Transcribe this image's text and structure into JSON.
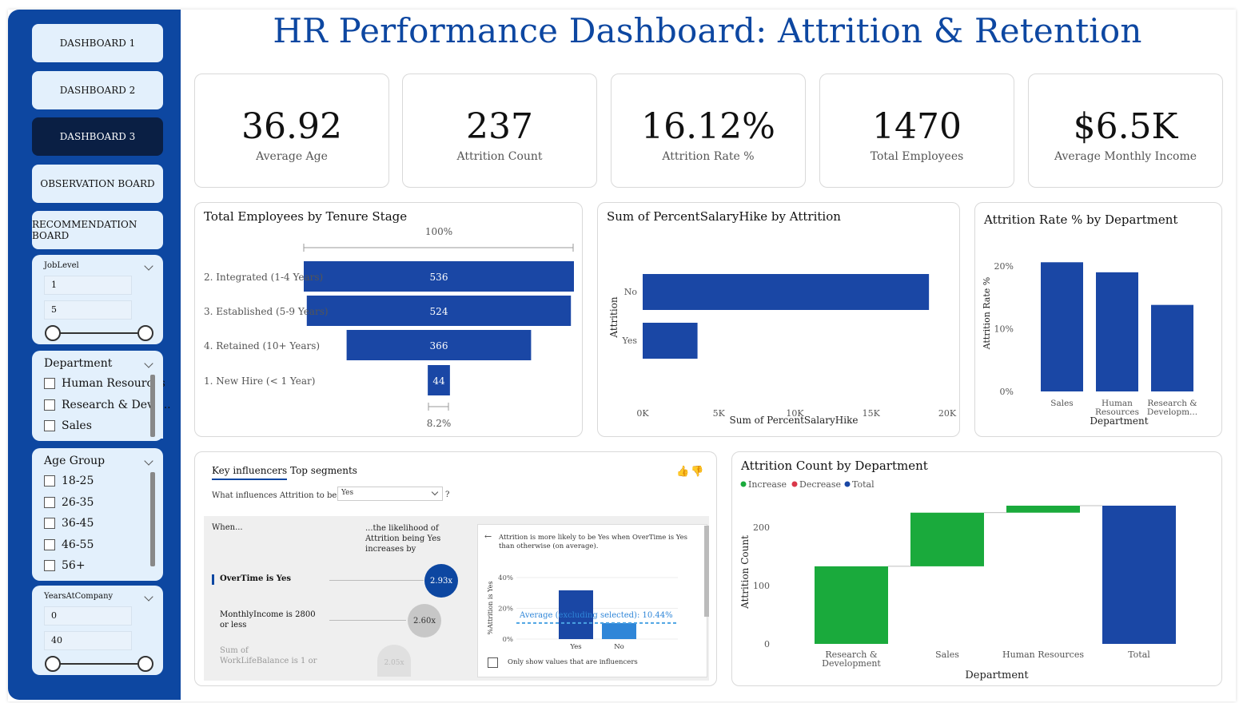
{
  "title": "HR Performance Dashboard: Attrition & Retention",
  "nav": {
    "dashboard1": "DASHBOARD 1",
    "dashboard2": "DASHBOARD 2",
    "dashboard3": "DASHBOARD 3",
    "observation": "OBSERVATION BOARD",
    "recommendation": "RECOMMENDATION BOARD",
    "active": "DASHBOARD 3"
  },
  "filters": {
    "joblevel": {
      "title": "JobLevel",
      "min": "1",
      "max": "5"
    },
    "department": {
      "title": "Department",
      "options": [
        "Human Resources",
        "Research & Deve...",
        "Sales"
      ]
    },
    "age_group": {
      "title": "Age Group",
      "options": [
        "18-25",
        "26-35",
        "36-45",
        "46-55",
        "56+"
      ]
    },
    "years": {
      "title": "YearsAtCompany",
      "min": "0",
      "max": "40"
    }
  },
  "kpis": [
    {
      "value": "36.92",
      "label": "Average Age"
    },
    {
      "value": "237",
      "label": "Attrition Count"
    },
    {
      "value": "16.12%",
      "label": "Attrition Rate %"
    },
    {
      "value": "1470",
      "label": "Total Employees"
    },
    {
      "value": "$6.5K",
      "label": "Average Monthly Income"
    }
  ],
  "colors": {
    "brand": "#0d47a1",
    "bar": "#1a47a5",
    "increase": "#1aaa3c",
    "decrease": "#d9384a",
    "total": "#1a47a5",
    "light": "#e3f0fc",
    "active_nav": "#0a1f44"
  },
  "chart_data": [
    {
      "type": "bar",
      "title": "Total Employees by Tenure Stage",
      "categories": [
        "2. Integrated (1-4 Years)",
        "3. Established (5-9 Years)",
        "4. Retained (10+ Years)",
        "1. New Hire (< 1 Year)"
      ],
      "values": [
        536,
        524,
        366,
        44
      ],
      "top_label": "100%",
      "bottom_label": "8.2%"
    },
    {
      "type": "bar",
      "title": "Sum of PercentSalaryHike by Attrition",
      "categories": [
        "No",
        "Yes"
      ],
      "values": [
        18800,
        3600
      ],
      "xlabel": "Sum of PercentSalaryHike",
      "ylabel": "Attrition",
      "xticks": [
        "0K",
        "5K",
        "10K",
        "15K",
        "20K"
      ],
      "xlim": [
        0,
        20000
      ]
    },
    {
      "type": "bar",
      "title": "Attrition Rate % by Department",
      "categories": [
        "Sales",
        "Human Resources",
        "Research & Developm..."
      ],
      "values": [
        20.6,
        19.0,
        13.8
      ],
      "xlabel": "Department",
      "ylabel": "Attrition Rate %",
      "yticks": [
        "0%",
        "10%",
        "20%"
      ],
      "ylim": [
        0,
        20
      ]
    },
    {
      "type": "bar",
      "title": "Attrition Count by Department",
      "legend": [
        "Increase",
        "Decrease",
        "Total"
      ],
      "categories": [
        "Research & Development",
        "Sales",
        "Human Resources",
        "Total"
      ],
      "values": [
        133,
        92,
        12,
        237
      ],
      "xlabel": "Department",
      "ylabel": "Attrition Count",
      "yticks": [
        "0",
        "100",
        "200"
      ],
      "ylim": [
        0,
        240
      ]
    }
  ],
  "key_influencers": {
    "tab1": "Key influencers",
    "tab2": "Top segments",
    "question": "What influences Attrition to be",
    "selected": "Yes",
    "qmark": "?",
    "col_when": "When...",
    "col_likelihood": "...the likelihood of Attrition being Yes increases by",
    "rows": [
      {
        "label": "OverTime is Yes",
        "value": "2.93x"
      },
      {
        "label": "MonthlyIncome is 2800 or less",
        "value": "2.60x"
      },
      {
        "label": "Sum of WorkLifeBalance is 1 or",
        "value": "2.05x"
      }
    ],
    "detail": {
      "text": "Attrition is more likely to be Yes when OverTime is Yes than otherwise (on average).",
      "ylabel": "%Attrition is Yes",
      "yticks": [
        "0%",
        "20%",
        "40%"
      ],
      "bars": [
        {
          "label": "Yes",
          "value": 31.7
        },
        {
          "label": "No",
          "value": 10.4
        }
      ],
      "average_label": "Average (excluding selected): 10.44%",
      "checkbox": "Only show values that are influencers"
    }
  }
}
